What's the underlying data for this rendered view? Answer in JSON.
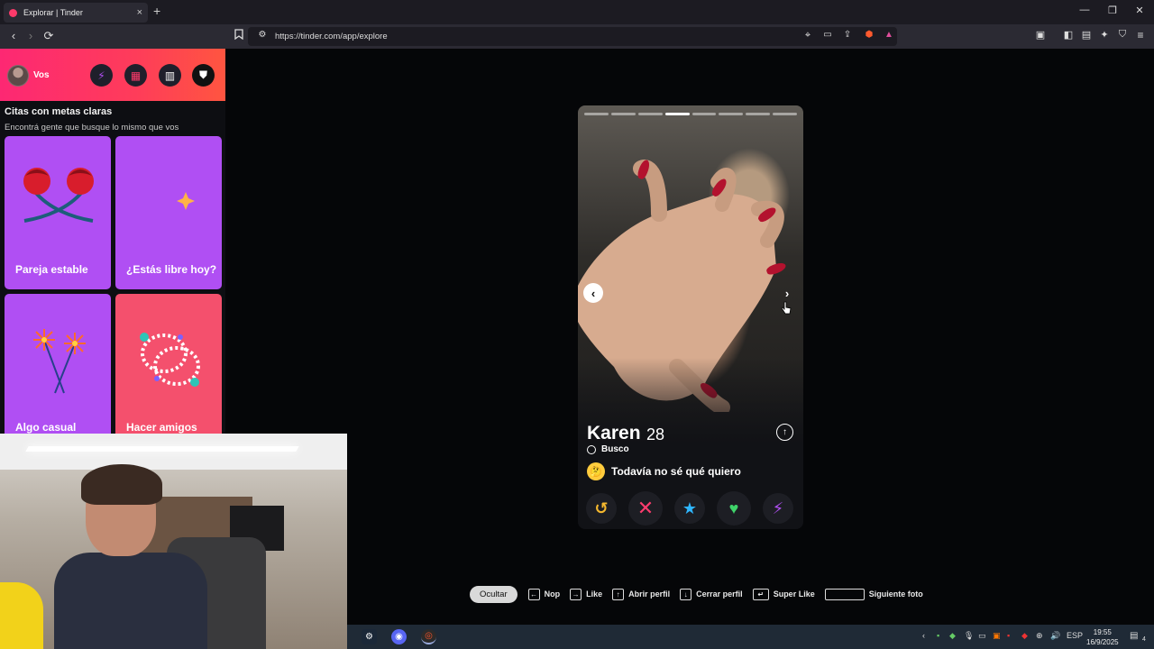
{
  "browser": {
    "tab_title": "Explorar | Tinder",
    "tab_close": "×",
    "new_tab": "+",
    "url": "https://tinder.com/app/explore",
    "window_controls": {
      "minimize": "—",
      "restore": "❐",
      "close": "✕"
    }
  },
  "sidebar": {
    "user_label": "Vos",
    "section_title": "Citas con metas claras",
    "section_subtitle": "Encontrá gente que busque lo mismo que vos",
    "cards": [
      {
        "label": "Pareja estable",
        "color": "#b04ff3",
        "icon": "roses-icon"
      },
      {
        "label": "¿Estás libre hoy?",
        "color": "#b04ff3",
        "icon": "moon-icon"
      },
      {
        "label": "Algo casual",
        "color": "#b04ff3",
        "icon": "sparklers-icon"
      },
      {
        "label": "Hacer amigos",
        "color": "#f4506d",
        "icon": "bracelet-icon"
      }
    ]
  },
  "profile": {
    "name": "Karen",
    "age": "28",
    "busco_label": "Busco",
    "goal": "Todavía no sé qué quiero",
    "goal_emoji": "🤔",
    "photo_count": 8,
    "current_photo": 4
  },
  "shortcuts": {
    "hide": "Ocultar",
    "items": [
      {
        "key": "←",
        "label": "Nop"
      },
      {
        "key": "→",
        "label": "Like"
      },
      {
        "key": "↑",
        "label": "Abrir perfil"
      },
      {
        "key": "↓",
        "label": "Cerrar perfil"
      },
      {
        "key": "↵",
        "label": "Super Like"
      },
      {
        "key": "",
        "label": "Siguiente foto"
      }
    ]
  },
  "taskbar": {
    "language": "ESP",
    "time": "19:55",
    "date": "16/9/2025",
    "notifications": "4"
  },
  "colors": {
    "brand_gradient_start": "#fd2873",
    "brand_gradient_end": "#ff5540",
    "rewind": "#f5b82e",
    "nope": "#ff3c6e",
    "superlike": "#2fb6ff",
    "like": "#3fd36a",
    "boost": "#b04ff3"
  }
}
